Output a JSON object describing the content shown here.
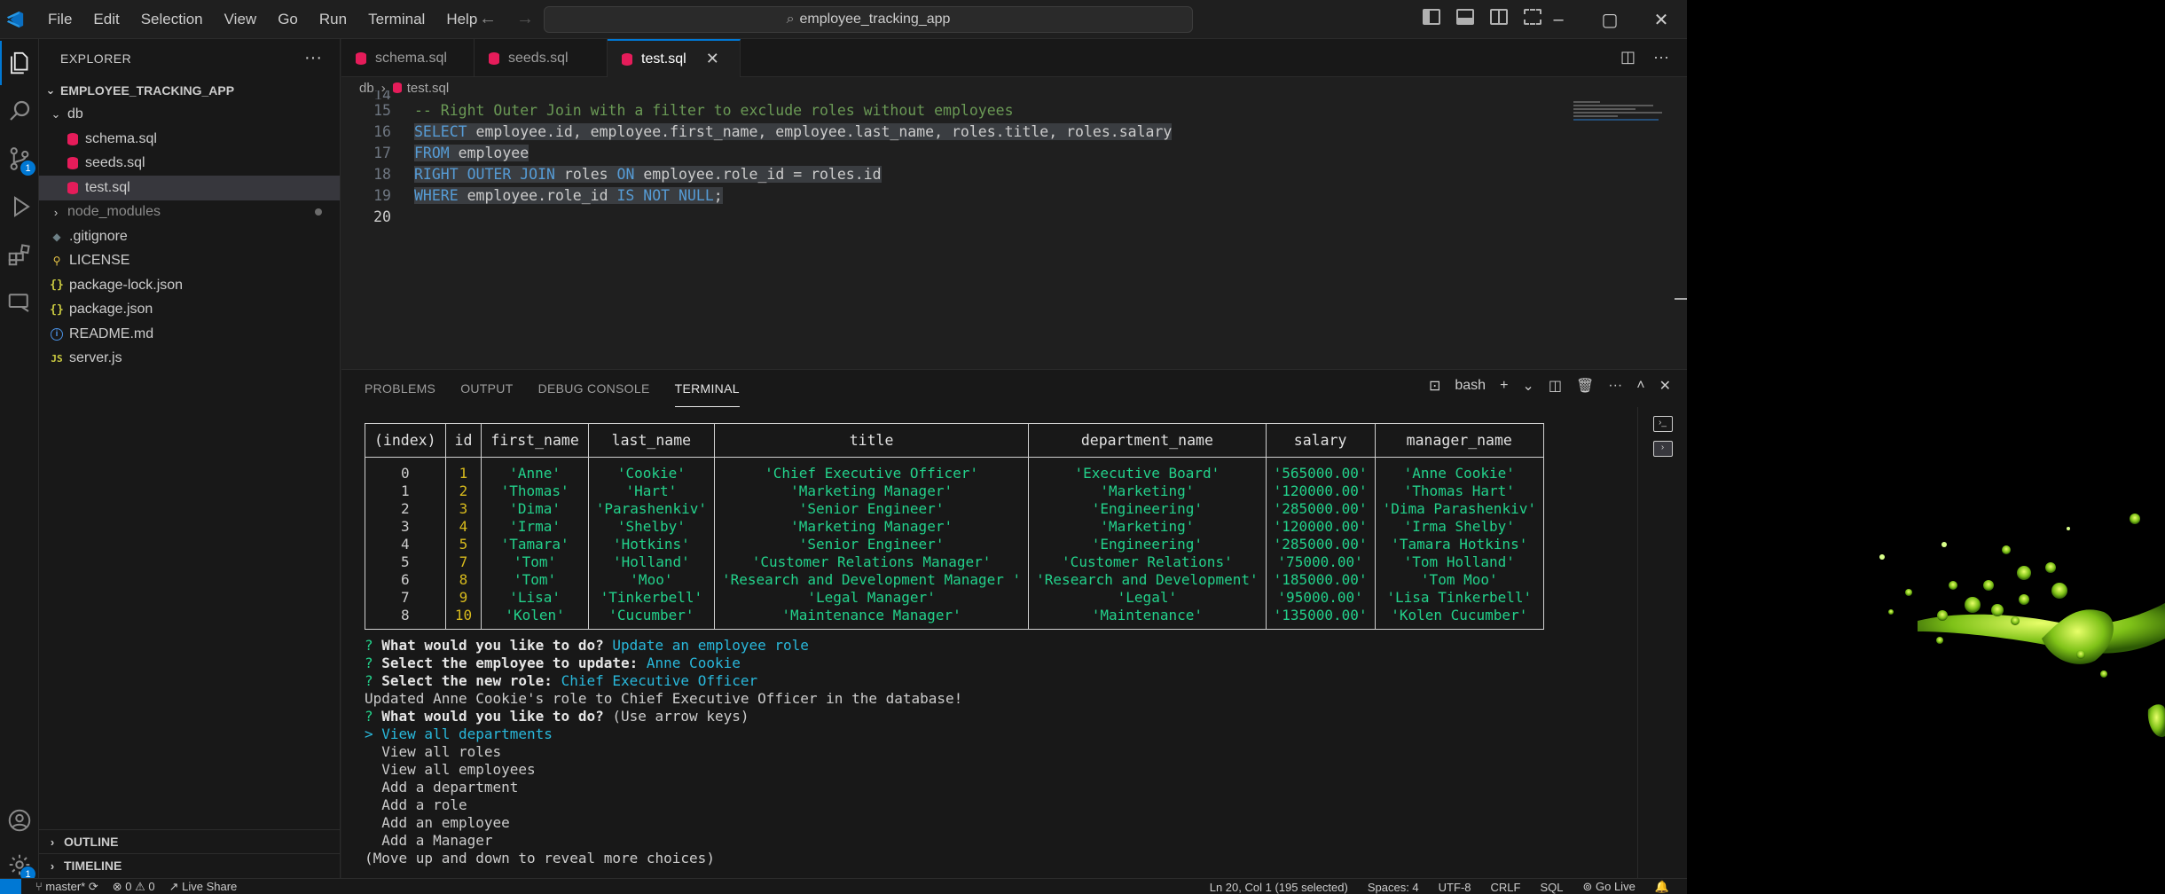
{
  "menu": [
    "File",
    "Edit",
    "Selection",
    "View",
    "Go",
    "Run",
    "Terminal",
    "Help"
  ],
  "search": {
    "text": "employee_tracking_app"
  },
  "window": {
    "minimize": "–",
    "maximize": "▢",
    "close": "✕"
  },
  "sidebar": {
    "title": "EXPLORER",
    "root": "EMPLOYEE_TRACKING_APP",
    "items": [
      {
        "label": "db",
        "type": "folder-open",
        "indent": 1
      },
      {
        "label": "schema.sql",
        "type": "sql",
        "indent": 2
      },
      {
        "label": "seeds.sql",
        "type": "sql",
        "indent": 2
      },
      {
        "label": "test.sql",
        "type": "sql",
        "indent": 2,
        "selected": true
      },
      {
        "label": "node_modules",
        "type": "folder",
        "indent": 1,
        "dimmed": true
      },
      {
        "label": ".gitignore",
        "type": "git",
        "indent": 1
      },
      {
        "label": "LICENSE",
        "type": "license",
        "indent": 1
      },
      {
        "label": "package-lock.json",
        "type": "json",
        "indent": 1
      },
      {
        "label": "package.json",
        "type": "json",
        "indent": 1
      },
      {
        "label": "README.md",
        "type": "info",
        "indent": 1
      },
      {
        "label": "server.js",
        "type": "js",
        "indent": 1
      }
    ],
    "outline": "OUTLINE",
    "timeline": "TIMELINE"
  },
  "tabs": [
    {
      "label": "schema.sql",
      "active": false
    },
    {
      "label": "seeds.sql",
      "active": false
    },
    {
      "label": "test.sql",
      "active": true
    }
  ],
  "breadcrumb": {
    "folder": "db",
    "file": "test.sql"
  },
  "code": {
    "partial_line": "14",
    "lines": [
      {
        "n": "15",
        "text": "-- Right Outer Join with a filter to exclude roles without employees"
      },
      {
        "n": "16",
        "text": "SELECT employee.id, employee.first_name, employee.last_name, roles.title, roles.salary"
      },
      {
        "n": "17",
        "text": "FROM employee"
      },
      {
        "n": "18",
        "text": "RIGHT OUTER JOIN roles ON employee.role_id = roles.id"
      },
      {
        "n": "19",
        "text": "WHERE employee.role_id IS NOT NULL;"
      },
      {
        "n": "20",
        "text": ""
      }
    ]
  },
  "panel": {
    "tabs": [
      "PROBLEMS",
      "OUTPUT",
      "DEBUG CONSOLE",
      "TERMINAL"
    ],
    "active_tab": "TERMINAL",
    "shell": "bash"
  },
  "table": {
    "headers": [
      "(index)",
      "id",
      "first_name",
      "last_name",
      "title",
      "department_name",
      "salary",
      "manager_name"
    ],
    "rows": [
      [
        "0",
        "1",
        "'Anne'",
        "'Cookie'",
        "'Chief Executive Officer'",
        "'Executive Board'",
        "'565000.00'",
        "'Anne Cookie'"
      ],
      [
        "1",
        "2",
        "'Thomas'",
        "'Hart'",
        "'Marketing Manager'",
        "'Marketing'",
        "'120000.00'",
        "'Thomas Hart'"
      ],
      [
        "2",
        "3",
        "'Dima'",
        "'Parashenkiv'",
        "'Senior Engineer'",
        "'Engineering'",
        "'285000.00'",
        "'Dima Parashenkiv'"
      ],
      [
        "3",
        "4",
        "'Irma'",
        "'Shelby'",
        "'Marketing Manager'",
        "'Marketing'",
        "'120000.00'",
        "'Irma Shelby'"
      ],
      [
        "4",
        "5",
        "'Tamara'",
        "'Hotkins'",
        "'Senior Engineer'",
        "'Engineering'",
        "'285000.00'",
        "'Tamara Hotkins'"
      ],
      [
        "5",
        "7",
        "'Tom'",
        "'Holland'",
        "'Customer Relations Manager'",
        "'Customer Relations'",
        "'75000.00'",
        "'Tom Holland'"
      ],
      [
        "6",
        "8",
        "'Tom'",
        "'Moo'",
        "'Research and Development Manager '",
        "'Research and Development'",
        "'185000.00'",
        "'Tom Moo'"
      ],
      [
        "7",
        "9",
        "'Lisa'",
        "'Tinkerbell'",
        "'Legal Manager'",
        "'Legal'",
        "'95000.00'",
        "'Lisa Tinkerbell'"
      ],
      [
        "8",
        "10",
        "'Kolen'",
        "'Cucumber'",
        "'Maintenance Manager'",
        "'Maintenance'",
        "'135000.00'",
        "'Kolen Cucumber'"
      ]
    ]
  },
  "prompts": {
    "q1": "What would you like to do?",
    "a1": "Update an employee role",
    "q2": "Select the employee to update:",
    "a2": "Anne Cookie",
    "q3": "Select the new role:",
    "a3": "Chief Executive Officer",
    "result": "Updated Anne Cookie's role to Chief Executive Officer in the database!",
    "q4": "What would you like to do?",
    "hint": "(Use arrow keys)",
    "choices": [
      "View all departments",
      "View all roles",
      "View all employees",
      "Add a department",
      "Add a role",
      "Add an employee",
      "Add a Manager"
    ],
    "selected_choice": "View all departments",
    "footer": "(Move up and down to reveal more choices)"
  },
  "status": {
    "branch": "master*",
    "problems": "0 ⚠ 0",
    "liveshare": "Live Share",
    "position": "Ln 20, Col 1 (195 selected)",
    "spaces": "Spaces: 4",
    "encoding": "UTF-8",
    "eol": "CRLF",
    "language": "SQL",
    "golive": "Go Live"
  },
  "colors": {
    "accent": "#0078d4",
    "string": "#23d18b",
    "number": "#d7ba1d",
    "keyword": "#569cd6",
    "comment": "#6a9955"
  }
}
